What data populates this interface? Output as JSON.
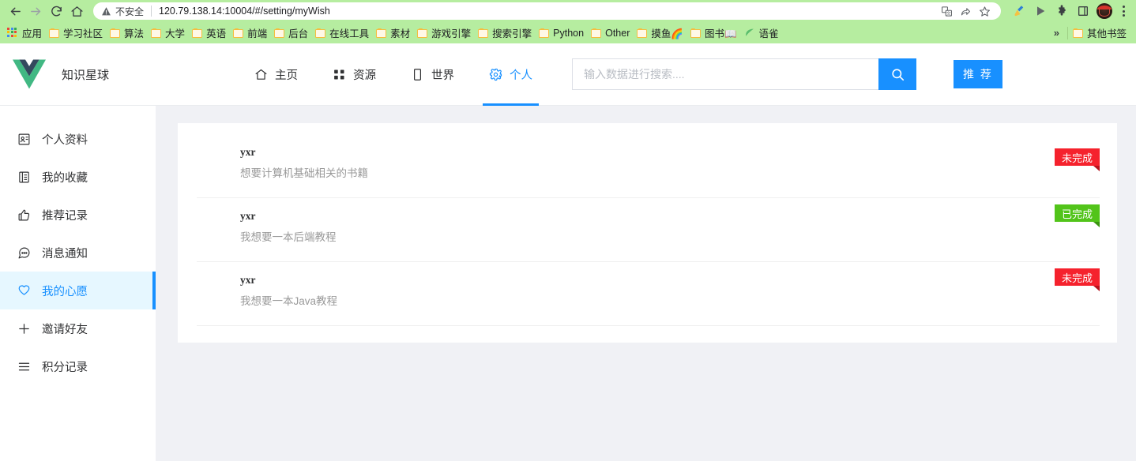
{
  "browser": {
    "back_tooltip": "后退",
    "forward_tooltip": "前进",
    "reload_tooltip": "重新加载",
    "home_tooltip": "主页",
    "security_label": "不安全",
    "url": "120.79.138.14:10004/#/setting/myWish",
    "apps_label": "应用",
    "overflow_label": "»",
    "other_bookmarks": "其他书签",
    "bookmarks": [
      {
        "label": "学习社区",
        "icon": "folder-icon"
      },
      {
        "label": "算法",
        "icon": "folder-icon"
      },
      {
        "label": "大学",
        "icon": "folder-icon"
      },
      {
        "label": "英语",
        "icon": "folder-icon"
      },
      {
        "label": "前端",
        "icon": "folder-icon"
      },
      {
        "label": "后台",
        "icon": "folder-icon"
      },
      {
        "label": "在线工具",
        "icon": "folder-icon"
      },
      {
        "label": "素材",
        "icon": "folder-icon"
      },
      {
        "label": "游戏引擎",
        "icon": "folder-icon"
      },
      {
        "label": "搜索引擎",
        "icon": "folder-icon"
      },
      {
        "label": "Python",
        "icon": "folder-icon"
      },
      {
        "label": "Other",
        "icon": "folder-icon"
      },
      {
        "label": "摸鱼🌈",
        "icon": "folder-icon"
      },
      {
        "label": "图书📖",
        "icon": "folder-icon"
      },
      {
        "label": "语雀",
        "icon": "leaf-icon"
      }
    ],
    "toolbar_icons": [
      "translate-icon",
      "share-icon",
      "bookmark-star-icon",
      "broom-extension-icon",
      "play-extension-icon",
      "puzzle-extensions-icon",
      "sidepanel-icon",
      "profile-avatar-icon",
      "menu-kebab-icon"
    ]
  },
  "header": {
    "logo": "vue-logo",
    "brand_title": "知识星球",
    "tabs": [
      {
        "label": "主页",
        "icon": "home-icon",
        "active": false
      },
      {
        "label": "资源",
        "icon": "grid-icon",
        "active": false
      },
      {
        "label": "世界",
        "icon": "book-icon",
        "active": false
      },
      {
        "label": "个人",
        "icon": "gear-icon",
        "active": true
      }
    ],
    "search": {
      "placeholder": "输入数据进行搜索....",
      "value": "",
      "button_icon": "search-icon"
    },
    "recommend_button": "推 荐",
    "avatar": "user-avatar"
  },
  "sidebar": {
    "items": [
      {
        "label": "个人资料",
        "icon": "profile-card-icon",
        "active": false
      },
      {
        "label": "我的收藏",
        "icon": "bookmark-list-icon",
        "active": false
      },
      {
        "label": "推荐记录",
        "icon": "thumbs-up-icon",
        "active": false
      },
      {
        "label": "消息通知",
        "icon": "chat-bubble-icon",
        "active": false
      },
      {
        "label": "我的心愿",
        "icon": "heart-icon",
        "active": true
      },
      {
        "label": "邀请好友",
        "icon": "plus-icon",
        "active": false
      },
      {
        "label": "积分记录",
        "icon": "list-lines-icon",
        "active": false
      }
    ]
  },
  "main": {
    "wishes": [
      {
        "user": "yxr",
        "description": "想要计算机基础相关的书籍",
        "status": "未完成",
        "status_type": "red"
      },
      {
        "user": "yxr",
        "description": "我想要一本后端教程",
        "status": "已完成",
        "status_type": "green"
      },
      {
        "user": "yxr",
        "description": "我想要一本Java教程",
        "status": "未完成",
        "status_type": "red"
      }
    ]
  },
  "colors": {
    "accent": "#1890ff",
    "browser_chrome": "#b6eda0",
    "status_done": "#52c41a",
    "status_pending": "#f5222d",
    "content_bg": "#f0f1f5",
    "active_item_bg": "#e6f7ff"
  }
}
